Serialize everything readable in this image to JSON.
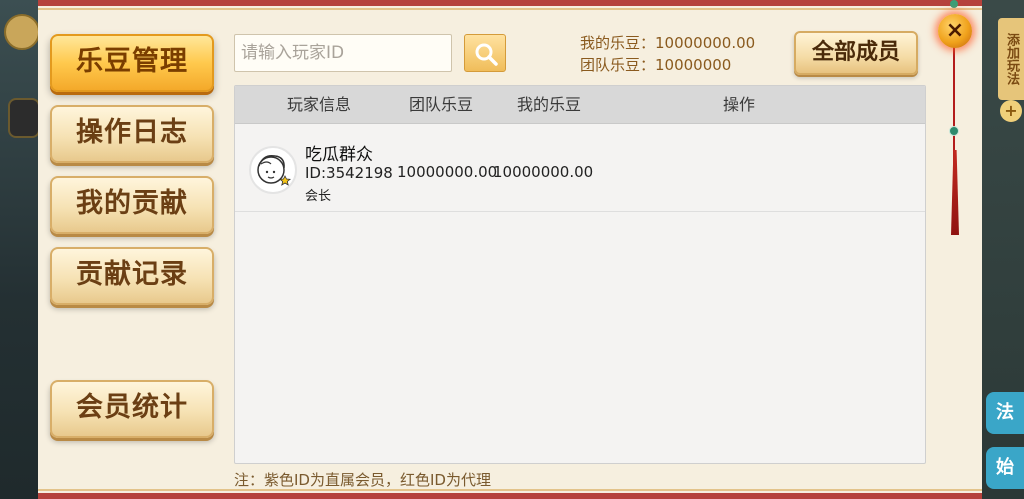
{
  "background": {
    "right_tab_text": "添加玩法",
    "right_plus": "+",
    "right_btn_1": "法",
    "right_btn_2": "始"
  },
  "menu": [
    {
      "label": "乐豆管理",
      "active": true
    },
    {
      "label": "操作日志",
      "active": false
    },
    {
      "label": "我的贡献",
      "active": false
    },
    {
      "label": "贡献记录",
      "active": false
    },
    {
      "label": "会员统计",
      "active": false
    }
  ],
  "search": {
    "placeholder": "请输入玩家ID",
    "value": "",
    "icon": "search-icon"
  },
  "balances": {
    "my_beans": "我的乐豆：10000000.00",
    "team_beans": "团队乐豆：10000000"
  },
  "all_members_label": "全部成员",
  "table": {
    "headers": [
      "玩家信息",
      "团队乐豆",
      "我的乐豆",
      "操作"
    ],
    "rows": [
      {
        "name": "吃瓜群众",
        "id": "ID:3542198",
        "role": "会长",
        "team_beans": "10000000.00",
        "my_beans": "10000000.00",
        "avatar_icon": "cartoon-avatar-icon"
      }
    ]
  },
  "note": "注：紫色ID为直属会员，红色ID为代理",
  "close_label": "×",
  "colors": {
    "panel_border": "#b5423c",
    "panel_bg": "#f6efdf",
    "active_btn": "#ffc94d",
    "text_brown": "#8a5a1e"
  }
}
